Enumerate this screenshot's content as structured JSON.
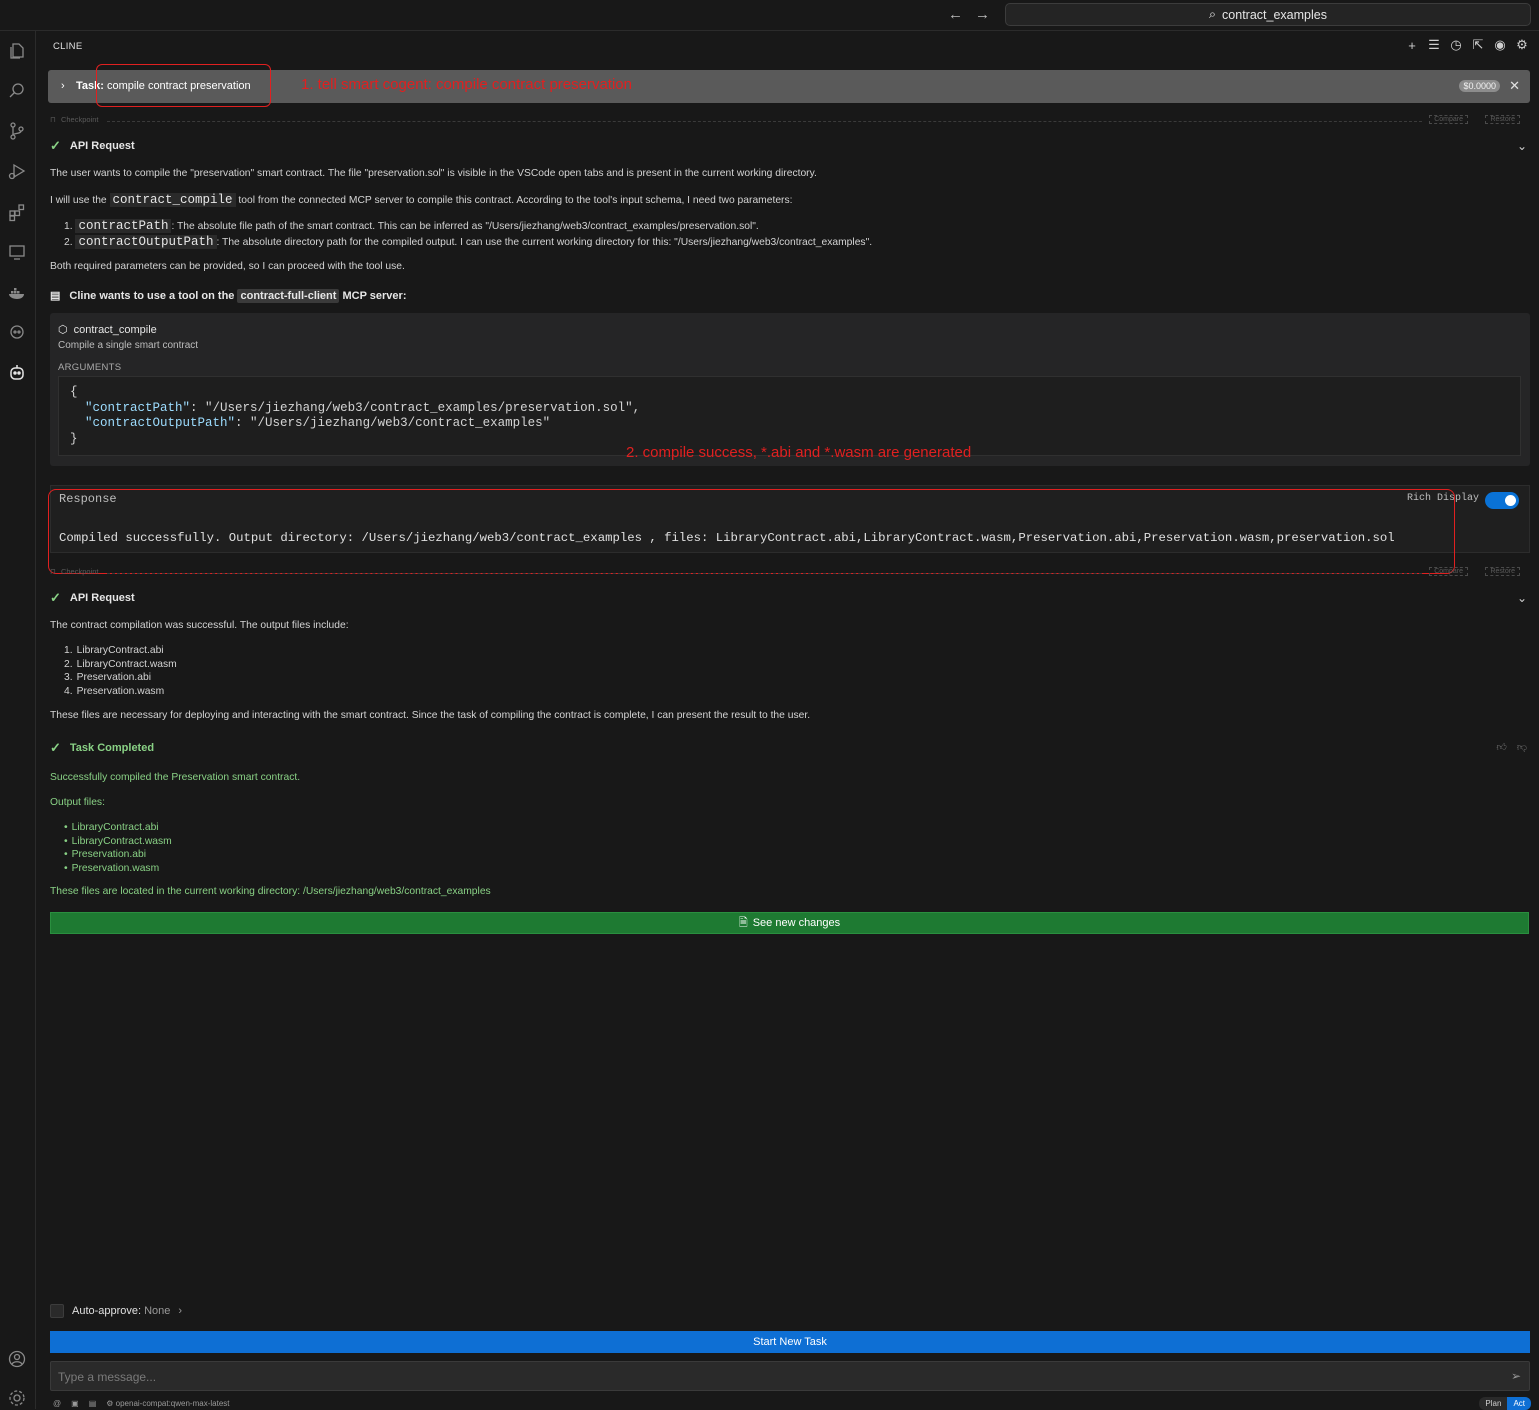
{
  "titlebar": {
    "search_text": "contract_examples"
  },
  "panel": {
    "title": "CLINE"
  },
  "task": {
    "prefix": "Task:",
    "text": "compile contract preservation",
    "cost": "$0.0000"
  },
  "annotations": {
    "one": "1. tell smart cogent: compile contract preservation",
    "two": "2. compile success, *.abi and *.wasm are generated"
  },
  "checkpoint": {
    "label": "Checkpoint",
    "compare": "Compare",
    "restore": "Restore"
  },
  "api1": {
    "title": "API Request",
    "p1": "The user wants to compile the \"preservation\" smart contract. The file \"preservation.sol\" is visible in the VSCode open tabs and is present in the current working directory.",
    "p2_before": "I will use the ",
    "p2_code": "contract_compile",
    "p2_after": " tool from the connected MCP server to compile this contract. According to the tool's input schema, I need two parameters:",
    "item1_num": "1.",
    "item1_code": "contractPath",
    "item1_text": ": The absolute file path of the smart contract. This can be inferred as \"/Users/jiezhang/web3/contract_examples/preservation.sol\".",
    "item2_num": "2.",
    "item2_code": "contractOutputPath",
    "item2_text": ": The absolute directory path for the compiled output. I can use the current working directory for this: \"/Users/jiezhang/web3/contract_examples\".",
    "p3": "Both required parameters can be provided, so I can proceed with the tool use."
  },
  "mcp": {
    "before": "Cline wants to use a tool on the ",
    "server": "contract-full-client",
    "after": " MCP server:"
  },
  "tool": {
    "name": "contract_compile",
    "desc": "Compile a single smart contract",
    "args_label": "ARGUMENTS",
    "open_brace": "{",
    "key1": "\"contractPath\"",
    "val1": ": \"/Users/jiezhang/web3/contract_examples/preservation.sol\",",
    "key2": "\"contractOutputPath\"",
    "val2": ": \"/Users/jiezhang/web3/contract_examples\"",
    "close_brace": "}"
  },
  "response": {
    "label": "Response",
    "rich_display": "Rich Display",
    "text": "Compiled successfully. Output directory: /Users/jiezhang/web3/contract_examples , files: LibraryContract.abi,LibraryContract.wasm,Preservation.abi,Preservation.wasm,preservation.sol"
  },
  "api2": {
    "title": "API Request",
    "p1": "The contract compilation was successful. The output files include:",
    "items": [
      "LibraryContract.abi",
      "LibraryContract.wasm",
      "Preservation.abi",
      "Preservation.wasm"
    ],
    "nums": [
      "1.",
      "2.",
      "3.",
      "4."
    ],
    "p2": "These files are necessary for deploying and interacting with the smart contract. Since the task of compiling the contract is complete, I can present the result to the user."
  },
  "completed": {
    "title": "Task Completed",
    "p1": "Successfully compiled the Preservation smart contract.",
    "p2": "Output files:",
    "items": [
      "LibraryContract.abi",
      "LibraryContract.wasm",
      "Preservation.abi",
      "Preservation.wasm"
    ],
    "p3": "These files are located in the current working directory: /Users/jiezhang/web3/contract_examples",
    "see_changes": "See new changes"
  },
  "footer": {
    "auto_approve_label": "Auto-approve:",
    "auto_approve_value": "None",
    "start_new_task": "Start New Task",
    "message_placeholder": "Type a message...",
    "model": "openai-compat:qwen-max-latest",
    "plan": "Plan",
    "act": "Act"
  }
}
